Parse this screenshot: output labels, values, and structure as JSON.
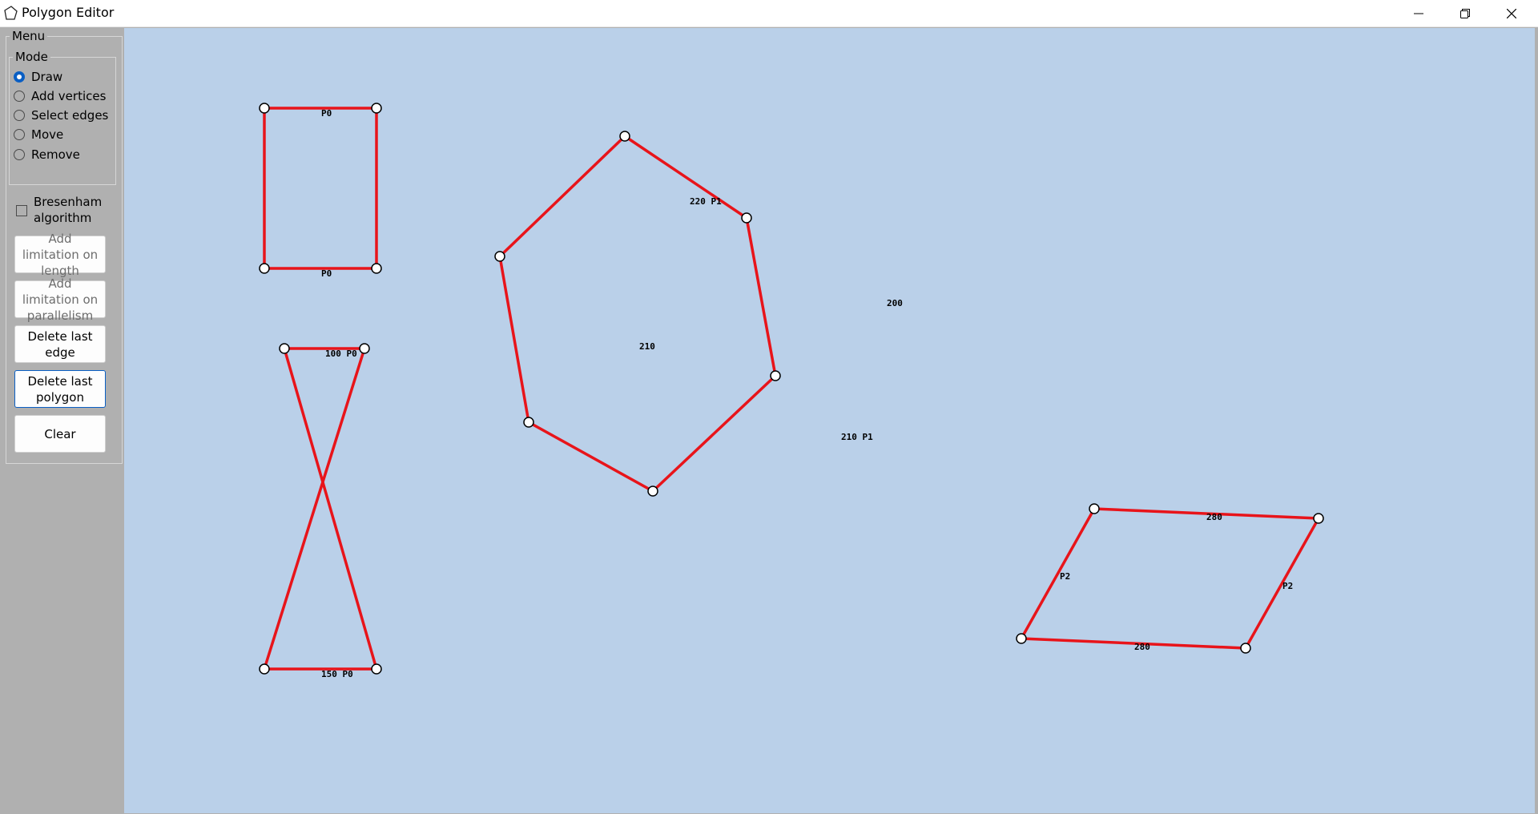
{
  "window": {
    "title": "Polygon Editor",
    "icons": {
      "app": "polygon-icon",
      "minimize": "minimize-icon",
      "maximize": "restore-icon",
      "close": "close-icon"
    }
  },
  "sidebar": {
    "menu_title": "Menu",
    "mode_title": "Mode",
    "modes": [
      {
        "label": "Draw",
        "selected": true
      },
      {
        "label": "Add vertices",
        "selected": false
      },
      {
        "label": "Select edges",
        "selected": false
      },
      {
        "label": "Move",
        "selected": false
      },
      {
        "label": "Remove",
        "selected": false
      }
    ],
    "bresenham": {
      "label": "Bresenham algorithm",
      "checked": false
    },
    "buttons": {
      "add_length": "Add limitation on length",
      "add_parallel": "Add limitation on parallelism",
      "delete_edge": "Delete last edge",
      "delete_polygon": "Delete last polygon",
      "clear": "Clear"
    }
  },
  "canvas": {
    "background": "#bad0e9",
    "edge_color": "#e8141a",
    "polygons": [
      {
        "name": "rectangle",
        "labels": [
          "P0",
          "P0"
        ]
      },
      {
        "name": "bowtie",
        "labels": [
          "100 P0",
          "150 P0"
        ]
      },
      {
        "name": "hexagon",
        "labels": [
          "220 P1",
          "200",
          "210",
          "210 P1"
        ]
      },
      {
        "name": "parallelogram",
        "labels": [
          "280",
          "P2",
          "P2",
          "280"
        ]
      }
    ]
  }
}
